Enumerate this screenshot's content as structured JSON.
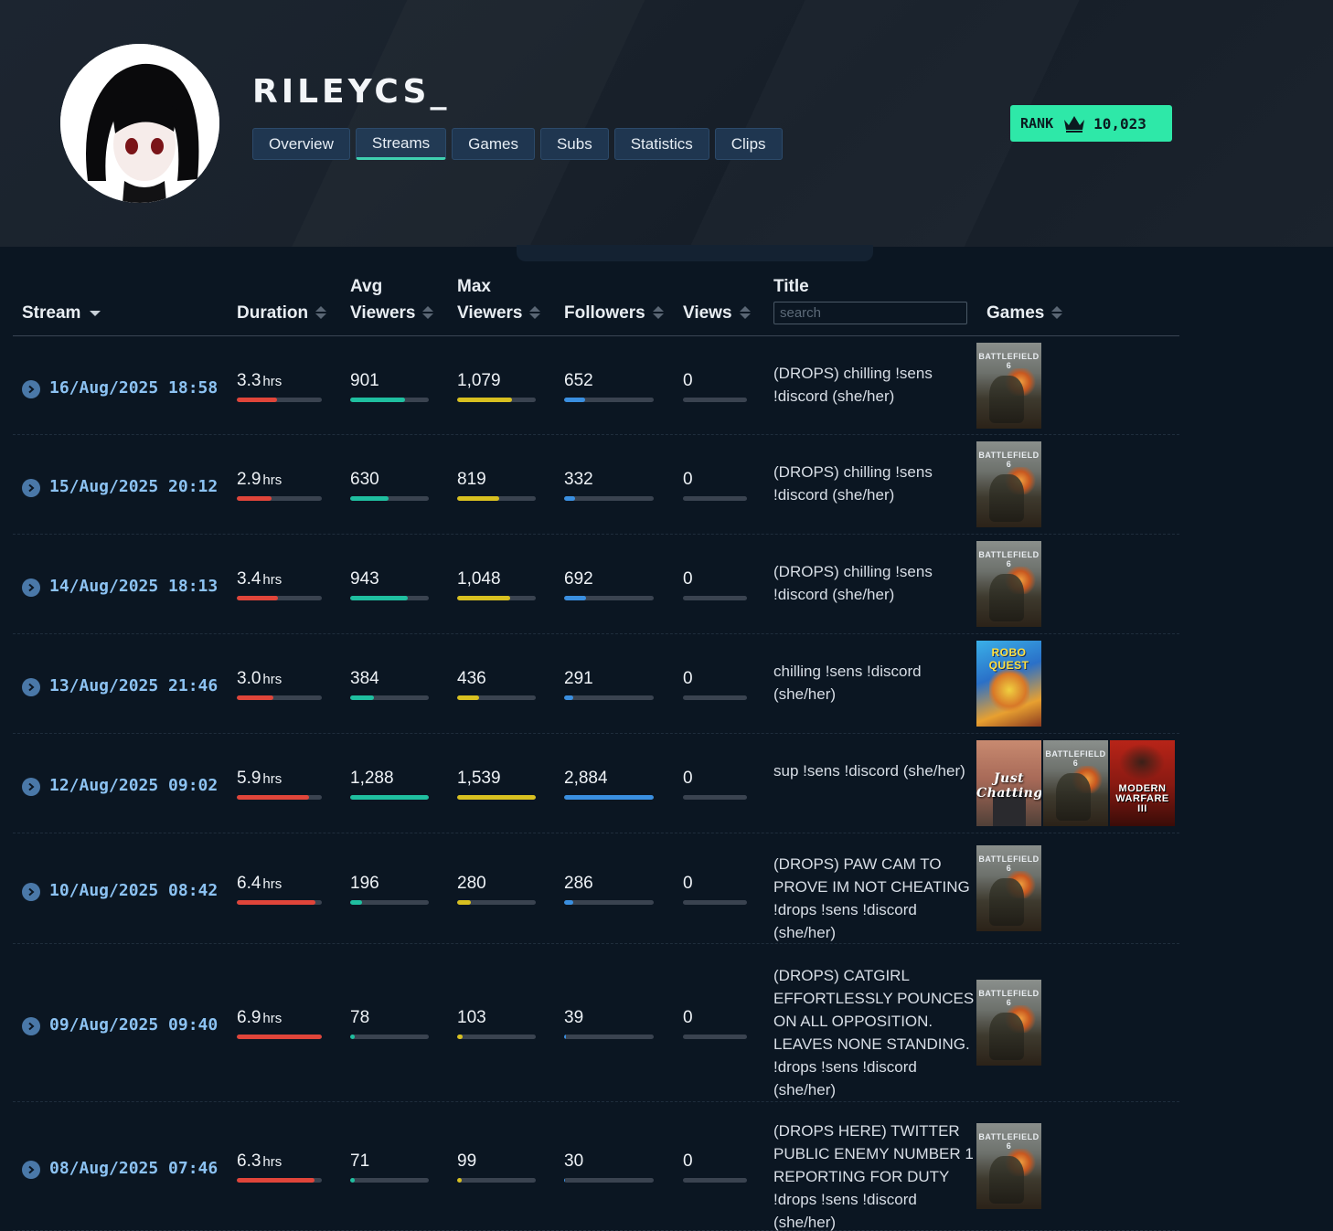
{
  "channel": {
    "name": "RILEYCS_"
  },
  "tabs": [
    {
      "label": "Overview",
      "active": false
    },
    {
      "label": "Streams",
      "active": true
    },
    {
      "label": "Games",
      "active": false
    },
    {
      "label": "Subs",
      "active": false
    },
    {
      "label": "Statistics",
      "active": false
    },
    {
      "label": "Clips",
      "active": false
    }
  ],
  "rank": {
    "label": "RANK",
    "value": "10,023",
    "color": "#2ee8a8"
  },
  "table": {
    "columns": {
      "stream": "Stream",
      "duration": "Duration",
      "avg_viewers_1": "Avg",
      "avg_viewers_2": "Viewers",
      "max_viewers_1": "Max",
      "max_viewers_2": "Viewers",
      "followers": "Followers",
      "views": "Views",
      "title": "Title",
      "games": "Games"
    },
    "title_search_placeholder": "search",
    "unit_hrs": "hrs",
    "bar_colors": {
      "duration": "#e0453a",
      "avg": "#1fbfa0",
      "max": "#d8c020",
      "followers": "#3a8fe0",
      "views": "#3a4350"
    },
    "rows": [
      {
        "date": "16/Aug/2025 18:58",
        "duration": "3.3",
        "duration_frac": 0.47,
        "avg": "901",
        "avg_frac": 0.7,
        "max": "1,079",
        "max_frac": 0.7,
        "followers": "652",
        "followers_frac": 0.23,
        "views": "0",
        "title": "(DROPS) chilling !sens !discord (she/her)",
        "games": [
          {
            "icon": "battlefield-6-cover",
            "caption": "BATTLEFIELD 6"
          }
        ]
      },
      {
        "date": "15/Aug/2025 20:12",
        "duration": "2.9",
        "duration_frac": 0.41,
        "avg": "630",
        "avg_frac": 0.49,
        "max": "819",
        "max_frac": 0.53,
        "followers": "332",
        "followers_frac": 0.12,
        "views": "0",
        "title": "(DROPS) chilling !sens !discord (she/her)",
        "games": [
          {
            "icon": "battlefield-6-cover",
            "caption": "BATTLEFIELD 6"
          }
        ]
      },
      {
        "date": "14/Aug/2025 18:13",
        "duration": "3.4",
        "duration_frac": 0.48,
        "avg": "943",
        "avg_frac": 0.73,
        "max": "1,048",
        "max_frac": 0.68,
        "followers": "692",
        "followers_frac": 0.24,
        "views": "0",
        "title": "(DROPS) chilling !sens !discord (she/her)",
        "games": [
          {
            "icon": "battlefield-6-cover",
            "caption": "BATTLEFIELD 6"
          }
        ]
      },
      {
        "date": "13/Aug/2025 21:46",
        "duration": "3.0",
        "duration_frac": 0.43,
        "avg": "384",
        "avg_frac": 0.3,
        "max": "436",
        "max_frac": 0.28,
        "followers": "291",
        "followers_frac": 0.1,
        "views": "0",
        "title": "chilling !sens !discord (she/her)",
        "games": [
          {
            "icon": "roboquest-cover",
            "caption": "ROBO QUEST"
          }
        ]
      },
      {
        "date": "12/Aug/2025 09:02",
        "duration": "5.9",
        "duration_frac": 0.85,
        "avg": "1,288",
        "avg_frac": 1.0,
        "max": "1,539",
        "max_frac": 1.0,
        "followers": "2,884",
        "followers_frac": 1.0,
        "views": "0",
        "title": "sup !sens !discord (she/her)",
        "games": [
          {
            "icon": "just-chatting-cover",
            "caption": "Just Chatting"
          },
          {
            "icon": "battlefield-6-cover",
            "caption": "BATTLEFIELD 6"
          },
          {
            "icon": "modern-warfare-3-cover",
            "caption": "MODERN WARFARE III"
          }
        ]
      },
      {
        "date": "10/Aug/2025 08:42",
        "duration": "6.4",
        "duration_frac": 0.92,
        "avg": "196",
        "avg_frac": 0.15,
        "max": "280",
        "max_frac": 0.18,
        "followers": "286",
        "followers_frac": 0.1,
        "views": "0",
        "title": "(DROPS) PAW CAM TO PROVE IM NOT CHEATING !drops !sens !discord (she/her)",
        "games": [
          {
            "icon": "battlefield-6-cover",
            "caption": "BATTLEFIELD 6"
          }
        ]
      },
      {
        "date": "09/Aug/2025 09:40",
        "duration": "6.9",
        "duration_frac": 1.0,
        "avg": "78",
        "avg_frac": 0.06,
        "max": "103",
        "max_frac": 0.07,
        "followers": "39",
        "followers_frac": 0.02,
        "views": "0",
        "title": "(DROPS) CATGIRL EFFORTLESSLY POUNCES ON ALL OPPOSITION. LEAVES NONE STANDING. !drops !sens !discord (she/her)",
        "games": [
          {
            "icon": "battlefield-6-cover",
            "caption": "BATTLEFIELD 6"
          }
        ]
      },
      {
        "date": "08/Aug/2025 07:46",
        "duration": "6.3",
        "duration_frac": 0.91,
        "avg": "71",
        "avg_frac": 0.06,
        "max": "99",
        "max_frac": 0.06,
        "followers": "30",
        "followers_frac": 0.01,
        "views": "0",
        "title": "(DROPS HERE) TWITTER PUBLIC ENEMY NUMBER 1 REPORTING FOR DUTY !drops !sens !discord (she/her)",
        "games": [
          {
            "icon": "battlefield-6-cover",
            "caption": "BATTLEFIELD 6"
          }
        ]
      }
    ]
  }
}
